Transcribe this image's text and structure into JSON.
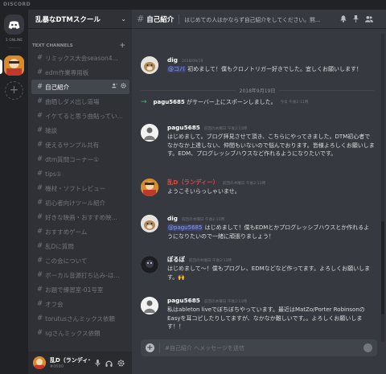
{
  "app": {
    "titlebar": "DISCORD"
  },
  "guilds": {
    "online_label": "1 ONLINE"
  },
  "server": {
    "name": "乱暴なDTMスクール"
  },
  "sidebar": {
    "category": "TEXT CHANNELS",
    "channels": [
      "リミックス大会season4...",
      "edm作業専用板",
      "自己紹介",
      "曲晒しダメ出し道場",
      "イケてると思う曲貼ってい...",
      "雑談",
      "使えるサンプル共有",
      "dtm質問コーナー①",
      "tips①",
      "機材・ソフトレビュー",
      "初心者向けツール紹介",
      "好きな映画・おすすめ映...",
      "おすすめゲーム",
      "乱Dに質問",
      "この会について",
      "ボーカル音源打ち込み-は...",
      "お題で練習室-01号室",
      "オフ会",
      "torutusさんミックス依頼",
      "sgさんミックス依頼"
    ],
    "active_index": 2
  },
  "user": {
    "name": "乱D（ランディー）",
    "tag": "#0690"
  },
  "header": {
    "channel": "自己紹介",
    "topic": "はじめての人はかならず自己紹介をしてください。黙..."
  },
  "messages": {
    "m1": {
      "author": "dig",
      "time": "2018/09/19",
      "mention": "@コバ",
      "text": " 初めまして！僕もクロノトリガー好きでした。宜しくお願いします！"
    },
    "date_divider": "2018年9月19日",
    "system": {
      "author": "pagu5685",
      "text": " がサーバー上にスポーンしました。",
      "time": "今日 午後2:11時"
    },
    "m2": {
      "author": "pagu5685",
      "time": "前回の木曜日 午後2:11時",
      "text": "はじめまして。ブログ拝見させて頂き、こちらにやってきました。DTM初心者でなかなか上達しない、仲間もいないので悩んでおります。皆様よろしくお願いします。EDM、プログレッシブハウスなど作れるようになりたいです。"
    },
    "m3": {
      "author": "乱D（ランディー）",
      "time": "前回の木曜日 午後2:11時",
      "text": "ようこそいらっしゃいませ。"
    },
    "m4": {
      "author": "dig",
      "time": "前回の木曜日 午後2:11時",
      "mention": "@pagu5685",
      "text": " はじめまして！僕もEDMとかプログレッシブハウスとか作れるようになりたいので一緒に頑張りましょう！"
    },
    "m5": {
      "author": "ぽるぽ",
      "time": "前回の木曜日 午後2:11時",
      "text": "はじめまして〜！僕もプログレ、EDMなどなど作ってます。よろしくお願いします。🙌"
    },
    "m6": {
      "author": "pagu5685",
      "time": "前回の木曜日 午後2:11時",
      "text": "私はableton liveでぼちぼちやっています。最近はMatZo/Porter RobinsonのEasyを耳コピしたりしてますが、なかなか難しいです。。よろしくお願いします！！"
    }
  },
  "composer": {
    "placeholder": "#自己紹介 へメッセージを送信"
  },
  "colors": {
    "accent": "#7289da",
    "mention_bg": "#3c4270",
    "online": "#43b581",
    "red_author": "#e04848"
  }
}
